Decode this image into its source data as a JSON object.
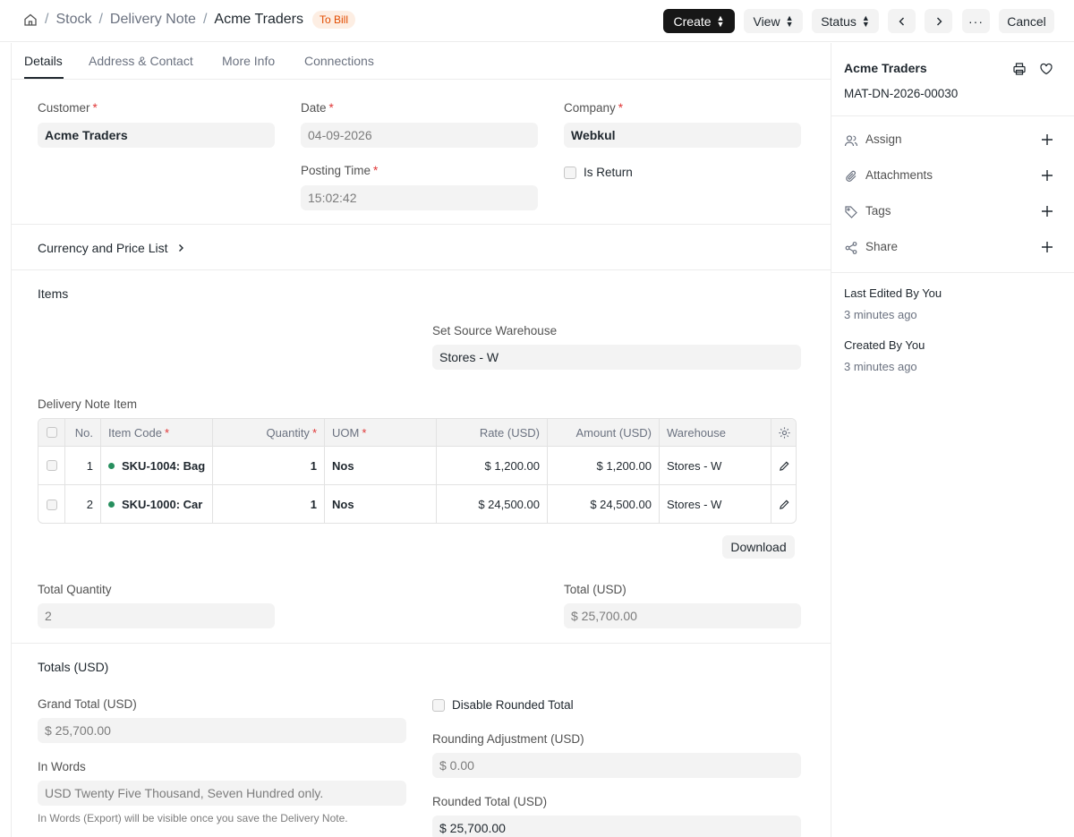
{
  "breadcrumb": {
    "items": [
      "Stock",
      "Delivery Note"
    ],
    "current": "Acme Traders",
    "status": "To Bill"
  },
  "toolbar": {
    "create_label": "Create",
    "view_label": "View",
    "status_label": "Status",
    "cancel_label": "Cancel"
  },
  "tabs": [
    "Details",
    "Address & Contact",
    "More Info",
    "Connections"
  ],
  "form": {
    "customer": {
      "label": "Customer",
      "value": "Acme Traders"
    },
    "date": {
      "label": "Date",
      "value": "04-09-2026"
    },
    "company": {
      "label": "Company",
      "value": "Webkul"
    },
    "posting_time": {
      "label": "Posting Time",
      "value": "15:02:42"
    },
    "is_return": {
      "label": "Is Return"
    },
    "currency_section": "Currency and Price List",
    "items_section": "Items",
    "source_warehouse": {
      "label": "Set Source Warehouse",
      "value": "Stores - W"
    },
    "items_table_label": "Delivery Note Item",
    "download_label": "Download",
    "total_quantity": {
      "label": "Total Quantity",
      "value": "2"
    },
    "total": {
      "label": "Total (USD)",
      "value": "$ 25,700.00"
    },
    "totals_section": "Totals (USD)",
    "grand_total": {
      "label": "Grand Total (USD)",
      "value": "$ 25,700.00"
    },
    "disable_rounded": {
      "label": "Disable Rounded Total"
    },
    "rounding_adjustment": {
      "label": "Rounding Adjustment (USD)",
      "value": "$ 0.00"
    },
    "in_words": {
      "label": "In Words",
      "value": "USD Twenty Five Thousand, Seven Hundred only."
    },
    "in_words_help": "In Words (Export) will be visible once you save the Delivery Note.",
    "rounded_total": {
      "label": "Rounded Total (USD)",
      "value": "$ 25,700.00"
    }
  },
  "items_table": {
    "headers": {
      "no": "No.",
      "item_code": "Item Code",
      "quantity": "Quantity",
      "uom": "UOM",
      "rate": "Rate (USD)",
      "amount": "Amount (USD)",
      "warehouse": "Warehouse"
    },
    "rows": [
      {
        "no": "1",
        "item_code": "SKU-1004: Bag",
        "quantity": "1",
        "uom": "Nos",
        "rate": "$ 1,200.00",
        "amount": "$ 1,200.00",
        "warehouse": "Stores - W"
      },
      {
        "no": "2",
        "item_code": "SKU-1000: Car",
        "quantity": "1",
        "uom": "Nos",
        "rate": "$ 24,500.00",
        "amount": "$ 24,500.00",
        "warehouse": "Stores - W"
      }
    ]
  },
  "sidebar": {
    "title": "Acme Traders",
    "doc_id": "MAT-DN-2026-00030",
    "actions": [
      "Assign",
      "Attachments",
      "Tags",
      "Share"
    ],
    "last_edited": "Last Edited By You",
    "last_edited_time": "3 minutes ago",
    "created": "Created By You",
    "created_time": "3 minutes ago"
  },
  "colors": {
    "accent_dark": "#171717",
    "status_badge_bg": "#fdeee3",
    "status_badge_text": "#e24c00",
    "required": "#e03636",
    "indicator_green": "#278f5e"
  }
}
